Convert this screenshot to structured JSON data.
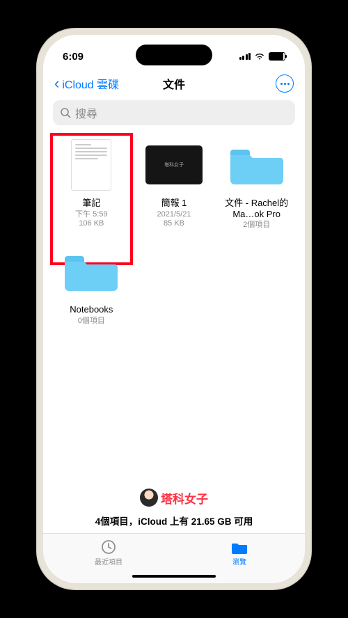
{
  "status": {
    "time": "6:09"
  },
  "nav": {
    "back": "iCloud 雲碟",
    "title": "文件"
  },
  "search": {
    "placeholder": "搜尋"
  },
  "files": [
    {
      "name": "筆記",
      "meta1": "下午 5:59",
      "meta2": "106 KB",
      "highlighted": true
    },
    {
      "name": "簡報 1",
      "meta1": "2021/5/21",
      "meta2": "85 KB"
    },
    {
      "name": "文件 - Rachel的Ma…ok Pro",
      "meta1": "2個項目",
      "meta2": ""
    },
    {
      "name": "Notebooks",
      "meta1": "0個項目",
      "meta2": ""
    }
  ],
  "keynote_label": "塔科女子",
  "watermark": "塔科女子",
  "storage": "4個項目，iCloud 上有 21.65 GB 可用",
  "tabs": {
    "recent": "最近項目",
    "browse": "瀏覽"
  }
}
